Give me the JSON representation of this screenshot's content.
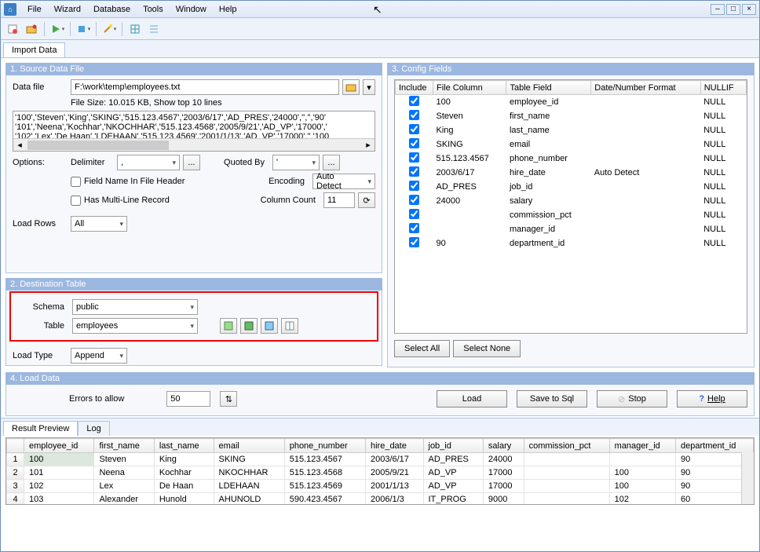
{
  "menubar": {
    "items": [
      "File",
      "Wizard",
      "Database",
      "Tools",
      "Window",
      "Help"
    ]
  },
  "tabs": {
    "import": "Import Data"
  },
  "source": {
    "title": "1. Source Data File",
    "datafile_label": "Data file",
    "datafile_value": "F:\\work\\temp\\employees.txt",
    "filesize": "File Size: 10.015 KB,  Show top 10 lines",
    "preview": [
      "'100','Steven','King','SKING','515.123.4567','2003/6/17','AD_PRES','24000','','','90'",
      "'101','Neena','Kochhar','NKOCHHAR','515.123.4568','2005/9/21','AD_VP','17000','",
      "'102','Lex','De Haan','LDEHAAN','515.123.4569','2001/1/13','AD_VP','17000','','100"
    ],
    "options_label": "Options:",
    "delimiter_label": "Delimiter",
    "delimiter_value": ",",
    "quotedby_label": "Quoted By",
    "quotedby_value": "'",
    "fieldname_label": "Field Name In File Header",
    "encoding_label": "Encoding",
    "encoding_value": "Auto Detect",
    "multiline_label": "Has Multi-Line Record",
    "colcount_label": "Column Count",
    "colcount_value": "11",
    "loadrows_label": "Load Rows",
    "loadrows_value": "All"
  },
  "dest": {
    "title": "2. Destination Table",
    "schema_label": "Schema",
    "schema_value": "public",
    "table_label": "Table",
    "table_value": "employees",
    "loadtype_label": "Load Type",
    "loadtype_value": "Append"
  },
  "config": {
    "title": "3. Config Fields",
    "headers": [
      "Include",
      "File Column",
      "Table Field",
      "Date/Number Format",
      "NULLIF"
    ],
    "rows": [
      {
        "inc": true,
        "fc": "100",
        "tf": "employee_id",
        "fmt": "",
        "nul": "NULL"
      },
      {
        "inc": true,
        "fc": "Steven",
        "tf": "first_name",
        "fmt": "",
        "nul": "NULL"
      },
      {
        "inc": true,
        "fc": "King",
        "tf": "last_name",
        "fmt": "",
        "nul": "NULL"
      },
      {
        "inc": true,
        "fc": "SKING",
        "tf": "email",
        "fmt": "",
        "nul": "NULL"
      },
      {
        "inc": true,
        "fc": "515.123.4567",
        "tf": "phone_number",
        "fmt": "",
        "nul": "NULL"
      },
      {
        "inc": true,
        "fc": "2003/6/17",
        "tf": "hire_date",
        "fmt": "Auto Detect",
        "nul": "NULL"
      },
      {
        "inc": true,
        "fc": "AD_PRES",
        "tf": "job_id",
        "fmt": "",
        "nul": "NULL"
      },
      {
        "inc": true,
        "fc": "24000",
        "tf": "salary",
        "fmt": "",
        "nul": "NULL"
      },
      {
        "inc": true,
        "fc": "",
        "tf": "commission_pct",
        "fmt": "",
        "nul": "NULL"
      },
      {
        "inc": true,
        "fc": "",
        "tf": "manager_id",
        "fmt": "",
        "nul": "NULL"
      },
      {
        "inc": true,
        "fc": "90",
        "tf": "department_id",
        "fmt": "",
        "nul": "NULL"
      }
    ],
    "select_all": "Select All",
    "select_none": "Select None"
  },
  "load": {
    "title": "4. Load Data",
    "errors_label": "Errors to allow",
    "errors_value": "50",
    "load_btn": "Load",
    "savesql_btn": "Save to Sql",
    "stop_btn": "Stop",
    "help_btn": "Help"
  },
  "result": {
    "tab_preview": "Result Preview",
    "tab_log": "Log",
    "headers": [
      "",
      "employee_id",
      "first_name",
      "last_name",
      "email",
      "phone_number",
      "hire_date",
      "job_id",
      "salary",
      "commission_pct",
      "manager_id",
      "department_id"
    ],
    "rows": [
      [
        "1",
        "100",
        "Steven",
        "King",
        "SKING",
        "515.123.4567",
        "2003/6/17",
        "AD_PRES",
        "24000",
        "",
        "",
        "90"
      ],
      [
        "2",
        "101",
        "Neena",
        "Kochhar",
        "NKOCHHAR",
        "515.123.4568",
        "2005/9/21",
        "AD_VP",
        "17000",
        "",
        "100",
        "90"
      ],
      [
        "3",
        "102",
        "Lex",
        "De Haan",
        "LDEHAAN",
        "515.123.4569",
        "2001/1/13",
        "AD_VP",
        "17000",
        "",
        "100",
        "90"
      ],
      [
        "4",
        "103",
        "Alexander",
        "Hunold",
        "AHUNOLD",
        "590.423.4567",
        "2006/1/3",
        "IT_PROG",
        "9000",
        "",
        "102",
        "60"
      ]
    ]
  }
}
